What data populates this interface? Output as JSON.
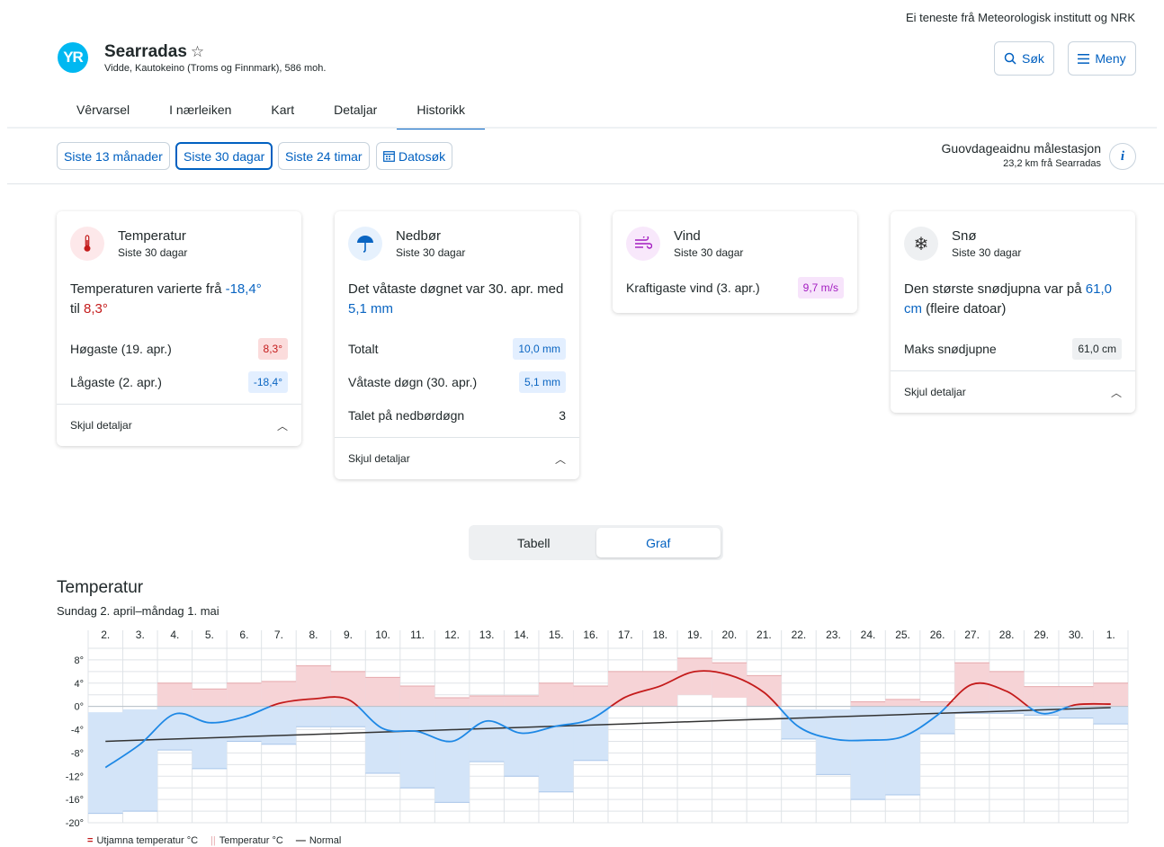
{
  "header": {
    "provider_note": "Ei teneste frå Meteorologisk institutt og NRK",
    "logo_text": "YR",
    "place_name": "Searradas",
    "place_desc": "Vidde, Kautokeino (Troms og Finnmark), 586 moh.",
    "search_label": "Søk",
    "menu_label": "Meny"
  },
  "tabs": [
    {
      "label": "Vêrvarsel"
    },
    {
      "label": "I nærleiken"
    },
    {
      "label": "Kart"
    },
    {
      "label": "Detaljar"
    },
    {
      "label": "Historikk",
      "active": true
    }
  ],
  "ranges": [
    {
      "label": "Siste 13 månader"
    },
    {
      "label": "Siste 30 dagar",
      "active": true
    },
    {
      "label": "Siste 24 timar"
    },
    {
      "label": "Datosøk"
    }
  ],
  "station": {
    "name": "Guovdageaidnu målestasjon",
    "distance": "23,2 km frå Searradas"
  },
  "cards": {
    "temperature": {
      "title": "Temperatur",
      "period": "Siste 30 dagar",
      "summary_a": "Temperaturen varierte frå ",
      "summary_min": "-18,4°",
      "summary_b": " til ",
      "summary_max": "8,3°",
      "rows": [
        {
          "label": "Høgaste (19. apr.)",
          "value": "8,3°"
        },
        {
          "label": "Lågaste (2. apr.)",
          "value": "-18,4°"
        }
      ],
      "toggle": "Skjul detaljar"
    },
    "precip": {
      "title": "Nedbør",
      "period": "Siste 30 dagar",
      "summary_a": "Det våtaste døgnet var 30. apr. med ",
      "summary_val": "5,1 mm",
      "rows": [
        {
          "label": "Totalt",
          "value": "10,0 mm"
        },
        {
          "label": "Våtaste døgn (30. apr.)",
          "value": "5,1 mm"
        },
        {
          "label": "Talet på nedbørdøgn",
          "value": "3"
        }
      ],
      "toggle": "Skjul detaljar"
    },
    "wind": {
      "title": "Vind",
      "period": "Siste 30 dagar",
      "rows": [
        {
          "label": "Kraftigaste vind (3. apr.)",
          "value": "9,7 m/s"
        }
      ]
    },
    "snow": {
      "title": "Snø",
      "period": "Siste 30 dagar",
      "summary_a": "Den største snødjupna var på ",
      "summary_val": "61,0 cm",
      "summary_b": " (fleire datoar)",
      "rows": [
        {
          "label": "Maks snødjupne",
          "value": "61,0 cm"
        }
      ],
      "toggle": "Skjul detaljar"
    }
  },
  "view_toggle": {
    "table": "Tabell",
    "graph": "Graf"
  },
  "chart": {
    "title": "Temperatur",
    "subtitle": "Sundag 2. april–måndag 1. mai",
    "legend": {
      "smoothed": "Utjamna temperatur °C",
      "temp": "Temperatur °C",
      "normal": "Normal"
    }
  },
  "chart_data": {
    "type": "bar",
    "categories": [
      "2.",
      "3.",
      "4.",
      "5.",
      "6.",
      "7.",
      "8.",
      "9.",
      "10.",
      "11.",
      "12.",
      "13.",
      "14.",
      "15.",
      "16.",
      "17.",
      "18.",
      "19.",
      "20.",
      "21.",
      "22.",
      "23.",
      "24.",
      "25.",
      "26.",
      "27.",
      "28.",
      "29.",
      "30.",
      "1."
    ],
    "ylim": [
      -20,
      10
    ],
    "yticks": [
      8,
      4,
      0,
      -4,
      -8,
      -12,
      -16,
      -20
    ],
    "series": [
      {
        "name": "Temperatur °C",
        "type": "range",
        "max": [
          -1,
          -0.5,
          4,
          3,
          4,
          4.3,
          7,
          6,
          5,
          3.5,
          1.5,
          1.8,
          1.8,
          4,
          3.5,
          6,
          6,
          8.3,
          7.5,
          5.3,
          -0.5,
          -0.5,
          0.8,
          1.2,
          0.8,
          7.5,
          6,
          3.4,
          3.4,
          4
        ],
        "min": [
          -18.4,
          -18,
          -7.5,
          -10.7,
          -6,
          -6.5,
          -3.5,
          -3.5,
          -11.5,
          -14,
          -16.5,
          -9.5,
          -12,
          -14.7,
          -9.3,
          0,
          0,
          2,
          1.5,
          0,
          -5.6,
          -11.7,
          -16,
          -15.2,
          -4.7,
          -1.2,
          -1.2,
          -1.5,
          -2,
          -3
        ]
      },
      {
        "name": "Utjamna temperatur °C",
        "type": "line",
        "values": [
          -10.5,
          -6.5,
          -1.3,
          -2.8,
          -1.8,
          0.5,
          1.3,
          1.2,
          -3.8,
          -4.3,
          -6,
          -2.5,
          -4.6,
          -3.4,
          -2.2,
          1.6,
          3.5,
          6,
          5.4,
          2.4,
          -3.5,
          -5.6,
          -5.8,
          -5.2,
          -1.5,
          3.8,
          2.6,
          -1.2,
          0.3,
          0.4
        ]
      },
      {
        "name": "Normal",
        "type": "line",
        "values": [
          -6,
          -5.8,
          -5.6,
          -5.4,
          -5.2,
          -5,
          -4.8,
          -4.6,
          -4.4,
          -4.2,
          -4,
          -3.8,
          -3.6,
          -3.4,
          -3.2,
          -3,
          -2.8,
          -2.6,
          -2.4,
          -2.2,
          -2,
          -1.8,
          -1.6,
          -1.4,
          -1.2,
          -1,
          -0.8,
          -0.6,
          -0.4,
          -0.2
        ]
      }
    ],
    "grid": true,
    "colors": {
      "warm": "#f6d3d6",
      "warm_edge": "#e6a9ad",
      "cold": "#d3e4f8",
      "cold_edge": "#a9c6ea",
      "smoothed_warm": "#c41b1b",
      "smoothed_cold": "#1e88e5",
      "normal": "#333333"
    }
  }
}
